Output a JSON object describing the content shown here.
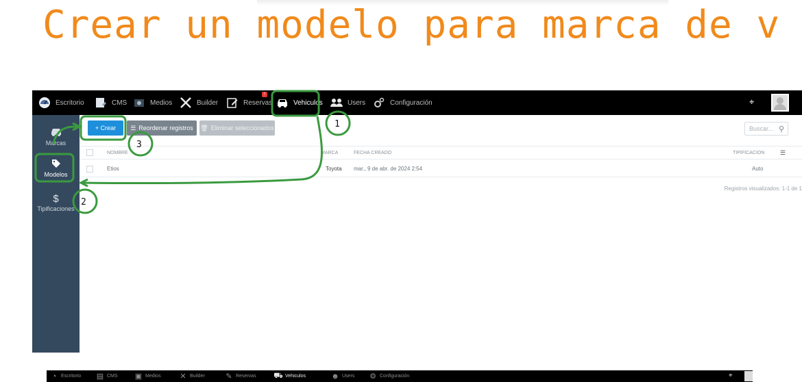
{
  "title": "Crear un modelo para marca de v",
  "nav": {
    "items": [
      {
        "label": "Escritorio",
        "icon": "dashboard-icon"
      },
      {
        "label": "CMS",
        "icon": "cms-icon"
      },
      {
        "label": "Medios",
        "icon": "media-icon"
      },
      {
        "label": "Builder",
        "icon": "tools-icon"
      },
      {
        "label": "Reservas",
        "icon": "edit-icon",
        "badge": "!"
      },
      {
        "label": "Vehiculos",
        "icon": "car-icon",
        "active": true
      },
      {
        "label": "Users",
        "icon": "users-icon"
      },
      {
        "label": "Configuración",
        "icon": "settings-icon"
      }
    ]
  },
  "sidebar": {
    "items": [
      {
        "label": "Marcas",
        "icon": "car-icon"
      },
      {
        "label": "Modelos",
        "icon": "tag-icon",
        "active": true
      },
      {
        "label": "Tipificaciones",
        "icon": "dollar-icon"
      }
    ]
  },
  "toolbar": {
    "create_label": "+ Crear",
    "reorder_label": "Reordenar registros",
    "delete_label": "Eliminar seleccionados",
    "search_placeholder": "Buscar..."
  },
  "table": {
    "columns": [
      "NOMBRE",
      "MARCA",
      "FECHA CREADO",
      "TIPIFICACION"
    ],
    "rows": [
      {
        "nombre": "Etios",
        "marca": "Toyota",
        "fecha": "mar., 9 de abr. de 2024 2:54",
        "tipificacion": "Auto"
      }
    ],
    "footer": "Registros visualizados: 1-1 de 1"
  },
  "annotations": {
    "step1": "1",
    "step2": "2",
    "step3": "3",
    "color": "#3a9a3f"
  },
  "colors": {
    "title": "#f08a1c",
    "primary_button": "#1e8fdb",
    "sidebar": "#34495e"
  }
}
